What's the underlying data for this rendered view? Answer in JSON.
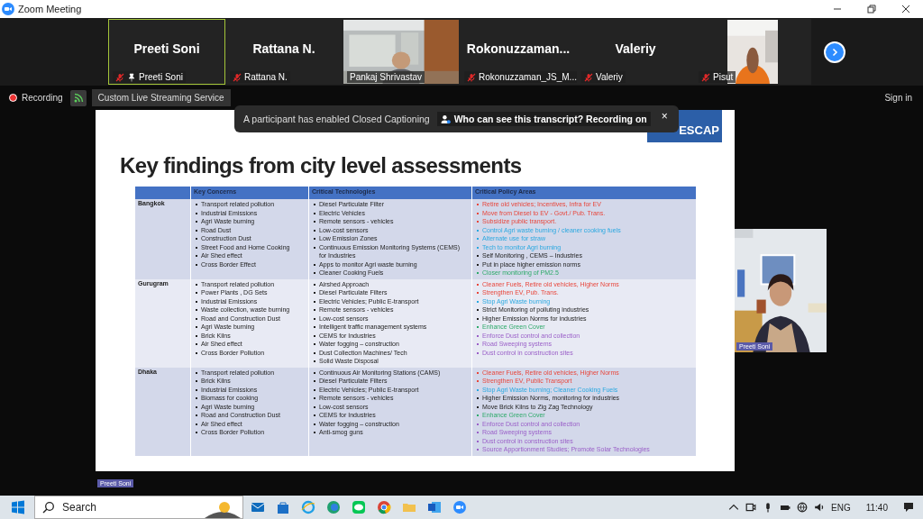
{
  "window": {
    "title": "Zoom Meeting"
  },
  "gallery": [
    {
      "kind": "name",
      "name": "Preeti Soni",
      "label": "Preeti Soni",
      "muted": true,
      "pinned": true,
      "speaking": true
    },
    {
      "kind": "name",
      "name": "Rattana N.",
      "label": "Rattana N.",
      "muted": true,
      "pinned": false,
      "speaking": false
    },
    {
      "kind": "video",
      "label": "Pankaj Shrivastav",
      "muted": false,
      "pinned": false,
      "speaking": false
    },
    {
      "kind": "name",
      "name": "Rokonuzzaman...",
      "label": "Rokonuzzaman_JS_M...",
      "muted": true,
      "pinned": false,
      "speaking": false
    },
    {
      "kind": "name",
      "name": "Valeriy",
      "label": "Valeriy",
      "muted": true,
      "pinned": false,
      "speaking": false
    },
    {
      "kind": "video",
      "label": "Pisut",
      "muted": true,
      "pinned": false,
      "speaking": false
    }
  ],
  "toolbar": {
    "recording": "Recording",
    "streaming": "Custom Live Streaming Service",
    "sign_in": "Sign in"
  },
  "notification": {
    "caption": "A participant has enabled Closed Captioning",
    "transcript": "Who can see this transcript? Recording on",
    "close": "×"
  },
  "slide": {
    "logo": "ESCAP",
    "title": "Key findings from city level assessments",
    "columns": [
      "Key Concerns",
      "Critical Technologies",
      "Critical Policy Areas"
    ],
    "rows": [
      {
        "city": "Bangkok",
        "concerns": [
          "Transport related pollution",
          "Industrial Emissions",
          "Agri Waste burning",
          "Road Dust",
          "Construction Dust",
          "Street Food and Home Cooking",
          "Air Shed effect",
          "Cross Border Effect"
        ],
        "technologies": [
          "Diesel Particulate Filter",
          "Electric Vehicles",
          "Remote sensors - vehicles",
          "Low-cost sensors",
          "Low Emission Zones",
          "Continuous Emission Monitoring Systems (CEMS) for Industries",
          "Apps to monitor Agri waste burning",
          "Cleaner Cooking Fuels"
        ],
        "policies": [
          {
            "text": "Retire old vehicles; Incentives, Infra for EV",
            "color": "#e8463b"
          },
          {
            "text": "Move from Diesel to EV - Govt./ Pub. Trans.",
            "color": "#e8463b"
          },
          {
            "text": "Subsidize public transport.",
            "color": "#e8463b"
          },
          {
            "text": "Control Agri waste burning / cleaner cooking fuels",
            "color": "#2aa8e0"
          },
          {
            "text": "Alternate use for straw",
            "color": "#2aa8e0"
          },
          {
            "text": "Tech to monitor Agri burning",
            "color": "#2aa8e0"
          },
          {
            "text": "Self Monitoring , CEMS – Industries",
            "color": "#222222"
          },
          {
            "text": "Put in place higher emission norms",
            "color": "#222222"
          },
          {
            "text": "Closer monitoring of PM2.5",
            "color": "#2eaa6a"
          }
        ]
      },
      {
        "city": "Gurugram",
        "concerns": [
          "Transport related pollution",
          "Power Plants , DG Sets",
          "Industrial Emissions",
          "Waste collection, waste burning",
          "Road and Construction Dust",
          "Agri Waste burning",
          "Brick Kilns",
          "Air Shed effect",
          "Cross Border Pollution"
        ],
        "technologies": [
          "Airshed Approach",
          "Diesel Particulate Filters",
          "Electric Vehicles; Public E-transport",
          "Remote sensors - vehicles",
          "Low-cost sensors",
          "Intelligent traffic management systems",
          "CEMS for Industries",
          "Water fogging – construction",
          "Dust  Collection Machines/ Tech",
          "Solid Waste Disposal"
        ],
        "policies": [
          {
            "text": "Cleaner Fuels, Retire old vehicles, Higher Norms",
            "color": "#e8463b"
          },
          {
            "text": "Strengthen EV, Pub. Trans.",
            "color": "#e8463b"
          },
          {
            "text": "Stop Agri Waste burning",
            "color": "#2aa8e0"
          },
          {
            "text": "Strict Monitoring of polluting industries",
            "color": "#222222"
          },
          {
            "text": "Higher Emission Norms for industries",
            "color": "#222222"
          },
          {
            "text": "Enhance Green Cover",
            "color": "#2eaa6a"
          },
          {
            "text": "Enforce Dust control and collection",
            "color": "#9a5fc8"
          },
          {
            "text": "Road Sweeping systems",
            "color": "#9a5fc8"
          },
          {
            "text": "Dust control in construction sites",
            "color": "#9a5fc8"
          }
        ]
      },
      {
        "city": "Dhaka",
        "concerns": [
          "Transport related pollution",
          "Brick Kilns",
          "Industrial Emissions",
          "Biomass for cooking",
          "Agri Waste burning",
          "Road and Construction Dust",
          "Air Shed effect",
          "Cross Border Pollution"
        ],
        "technologies": [
          "Continuous Air Monitoring Stations (CAMS)",
          "Diesel Particulate Filters",
          "Electric Vehicles; Public E-transport",
          "Remote sensors - vehicles",
          "Low-cost sensors",
          "CEMS for Industries",
          "Water fogging – construction",
          "Anti-smog guns"
        ],
        "policies": [
          {
            "text": "Cleaner Fuels, Retire old vehicles, Higher Norms",
            "color": "#e8463b"
          },
          {
            "text": "Strengthen EV, Public Transport",
            "color": "#e8463b"
          },
          {
            "text": "Stop Agri Waste burning; Cleaner Cooking Fuels",
            "color": "#2aa8e0"
          },
          {
            "text": "Higher Emission Norms, monitoring  for industries",
            "color": "#222222"
          },
          {
            "text": "Move Brick Kilns to Zig Zag Technology",
            "color": "#222222"
          },
          {
            "text": "Enhance Green Cover",
            "color": "#2eaa6a"
          },
          {
            "text": "Enforce Dust control and collection",
            "color": "#9a5fc8"
          },
          {
            "text": "Road Sweeping systems",
            "color": "#9a5fc8"
          },
          {
            "text": "Dust control in construction sites",
            "color": "#9a5fc8"
          },
          {
            "text": "Source Apportionment Studies; Promote Solar Technologies",
            "color": "#9a5fc8"
          }
        ]
      }
    ]
  },
  "speaker": {
    "name": "Preeti Soni"
  },
  "share_label": "Preeti Soni",
  "taskbar": {
    "search": "Search",
    "language": "ENG",
    "time": "11:40"
  }
}
